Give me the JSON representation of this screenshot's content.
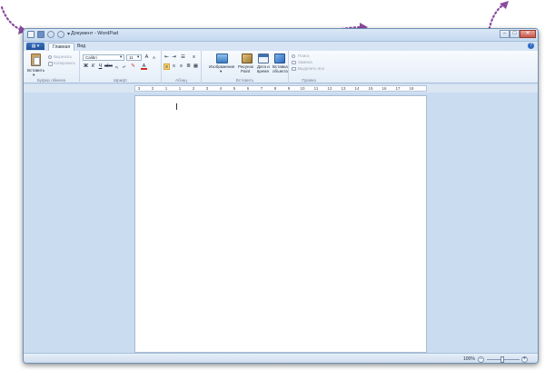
{
  "window": {
    "title": "Документ - WordPad"
  },
  "tabs": {
    "file_label": "",
    "home": "Главная",
    "view": "Вид"
  },
  "ribbon": {
    "clipboard": {
      "label": "Буфер обмена",
      "paste": "Вставить",
      "cut": "Вырезать",
      "copy": "Копировать"
    },
    "font": {
      "label": "Шрифт",
      "family": "Calibri",
      "size": "11",
      "bold": "Ж",
      "italic": "К",
      "underline": "Ч"
    },
    "paragraph": {
      "label": "Абзац"
    },
    "insert": {
      "label": "Вставить",
      "picture": "Изображение",
      "paint_line1": "Рисунок",
      "paint_line2": "Paint",
      "datetime_line1": "Дата и",
      "datetime_line2": "время",
      "object_line1": "Вставка",
      "object_line2": "объекта"
    },
    "editing": {
      "label": "Правка",
      "find": "Поиск",
      "replace": "Замена",
      "select_all": "Выделить все"
    }
  },
  "ruler": {
    "labels": [
      "3",
      "2",
      "1",
      "1",
      "2",
      "3",
      "4",
      "5",
      "6",
      "7",
      "8",
      "9",
      "10",
      "11",
      "12",
      "13",
      "14",
      "15",
      "16",
      "17",
      "18"
    ]
  },
  "statusbar": {
    "zoom": "100%",
    "zoom_out": "−",
    "zoom_in": "+"
  },
  "colors": {
    "accent": "#2e6bc4",
    "arrow": "#8b4aa0",
    "frame": "#c9dcf0"
  }
}
